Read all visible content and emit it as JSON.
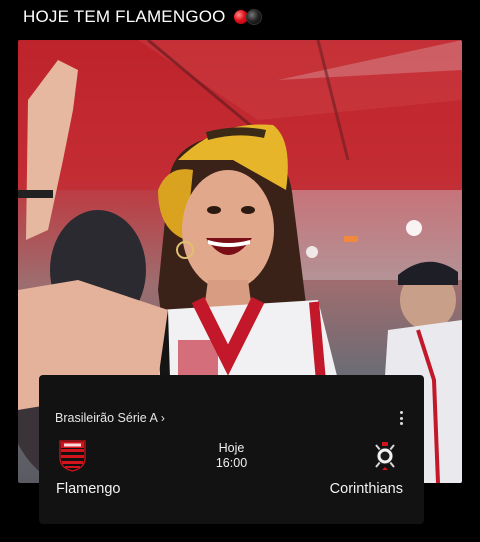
{
  "post": {
    "title": "HOJE TEM FLAMENGOO",
    "emoji_icons": [
      "red-ball-icon",
      "black-ball-icon"
    ]
  },
  "photo": {
    "description_icon": "fan-photo"
  },
  "match_card": {
    "competition": "Brasileirão Série A",
    "competition_chevron": "›",
    "day": "Hoje",
    "time": "16:00",
    "home_team": "Flamengo",
    "away_team": "Corinthians",
    "home_crest_icon": "flamengo-crest-icon",
    "away_crest_icon": "corinthians-crest-icon",
    "menu_icon": "more-vertical-icon"
  },
  "colors": {
    "background": "#000000",
    "card": "#121212",
    "flamengo_red": "#d3141c",
    "flamengo_black": "#111111"
  }
}
